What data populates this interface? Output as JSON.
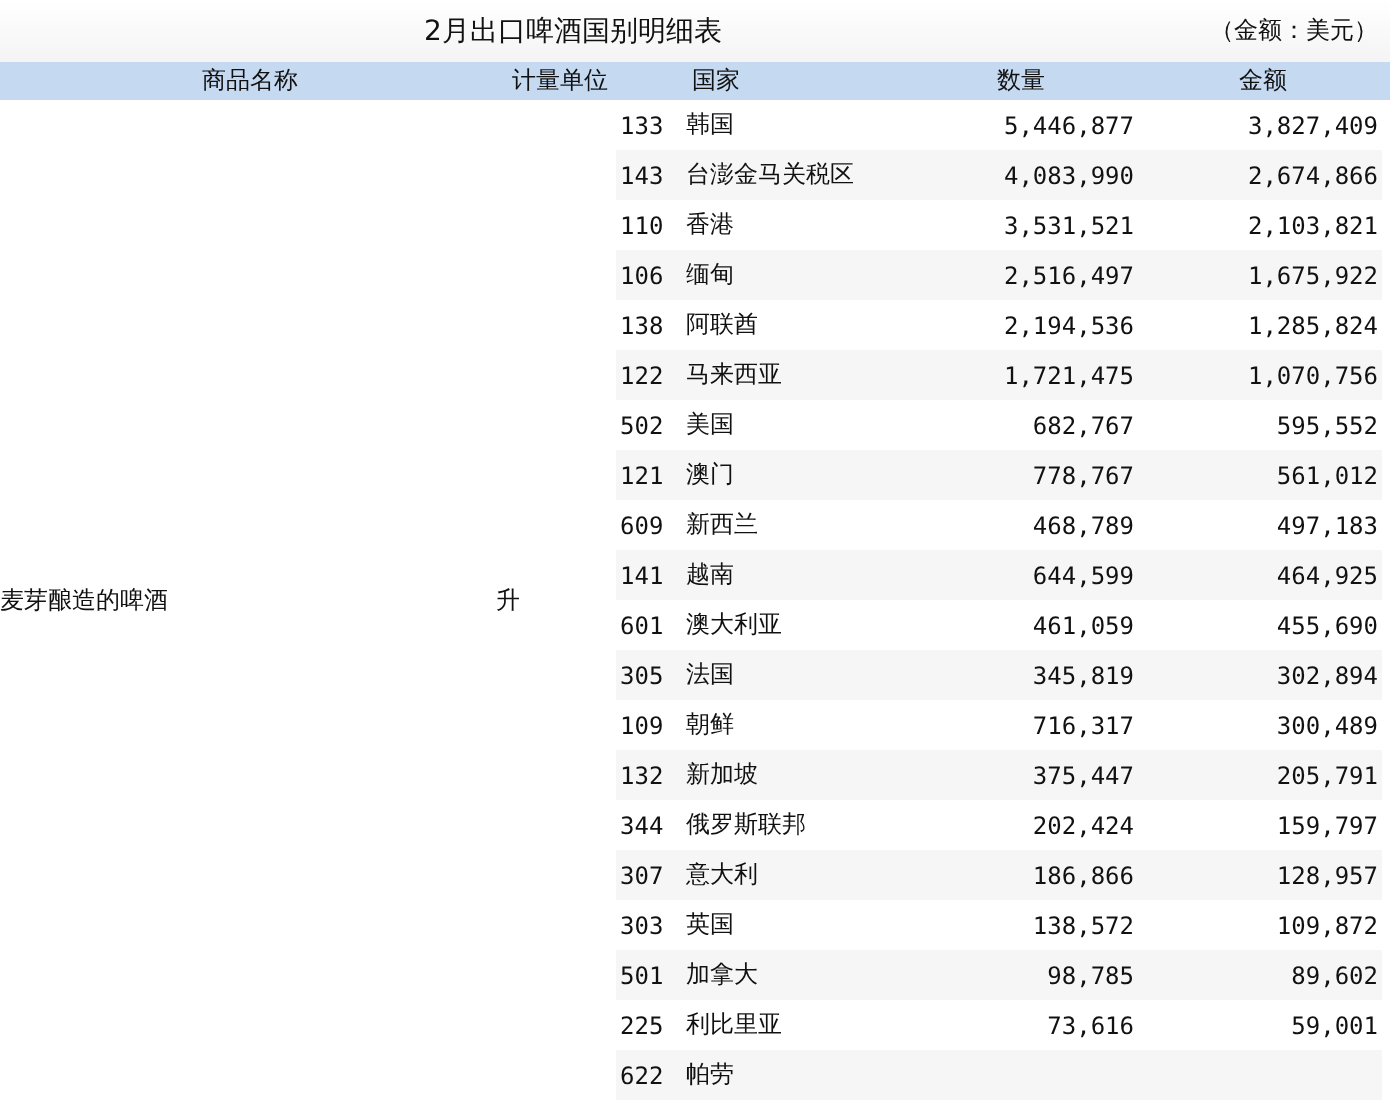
{
  "title": "2月出口啤酒国别明细表",
  "unit_note": "（金额：美元）",
  "table": {
    "columns": [
      "商品名称",
      "计量单位",
      "国家",
      "数量",
      "金额"
    ],
    "product": "麦芽酿造的啤酒",
    "unit": "升",
    "rows": [
      {
        "code": "133",
        "country": "韩国",
        "quantity": "5,446,877",
        "amount": "3,827,409"
      },
      {
        "code": "143",
        "country": "台澎金马关税区",
        "quantity": "4,083,990",
        "amount": "2,674,866"
      },
      {
        "code": "110",
        "country": "香港",
        "quantity": "3,531,521",
        "amount": "2,103,821"
      },
      {
        "code": "106",
        "country": "缅甸",
        "quantity": "2,516,497",
        "amount": "1,675,922"
      },
      {
        "code": "138",
        "country": "阿联酋",
        "quantity": "2,194,536",
        "amount": "1,285,824"
      },
      {
        "code": "122",
        "country": "马来西亚",
        "quantity": "1,721,475",
        "amount": "1,070,756"
      },
      {
        "code": "502",
        "country": "美国",
        "quantity": "682,767",
        "amount": "595,552"
      },
      {
        "code": "121",
        "country": "澳门",
        "quantity": "778,767",
        "amount": "561,012"
      },
      {
        "code": "609",
        "country": "新西兰",
        "quantity": "468,789",
        "amount": "497,183"
      },
      {
        "code": "141",
        "country": "越南",
        "quantity": "644,599",
        "amount": "464,925"
      },
      {
        "code": "601",
        "country": "澳大利亚",
        "quantity": "461,059",
        "amount": "455,690"
      },
      {
        "code": "305",
        "country": "法国",
        "quantity": "345,819",
        "amount": "302,894"
      },
      {
        "code": "109",
        "country": "朝鲜",
        "quantity": "716,317",
        "amount": "300,489"
      },
      {
        "code": "132",
        "country": "新加坡",
        "quantity": "375,447",
        "amount": "205,791"
      },
      {
        "code": "344",
        "country": "俄罗斯联邦",
        "quantity": "202,424",
        "amount": "159,797"
      },
      {
        "code": "307",
        "country": "意大利",
        "quantity": "186,866",
        "amount": "128,957"
      },
      {
        "code": "303",
        "country": "英国",
        "quantity": "138,572",
        "amount": "109,872"
      },
      {
        "code": "501",
        "country": "加拿大",
        "quantity": "98,785",
        "amount": "89,602"
      },
      {
        "code": "225",
        "country": "利比里亚",
        "quantity": "73,616",
        "amount": "59,001"
      },
      {
        "code": "622",
        "country": "帕劳"
      }
    ]
  }
}
